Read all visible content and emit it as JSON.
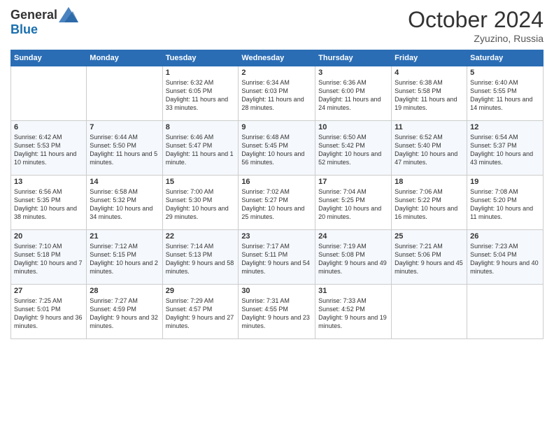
{
  "header": {
    "logo_general": "General",
    "logo_blue": "Blue",
    "month": "October 2024",
    "location": "Zyuzino, Russia"
  },
  "days_of_week": [
    "Sunday",
    "Monday",
    "Tuesday",
    "Wednesday",
    "Thursday",
    "Friday",
    "Saturday"
  ],
  "weeks": [
    [
      {
        "day": "",
        "sunrise": "",
        "sunset": "",
        "daylight": ""
      },
      {
        "day": "",
        "sunrise": "",
        "sunset": "",
        "daylight": ""
      },
      {
        "day": "1",
        "sunrise": "Sunrise: 6:32 AM",
        "sunset": "Sunset: 6:05 PM",
        "daylight": "Daylight: 11 hours and 33 minutes."
      },
      {
        "day": "2",
        "sunrise": "Sunrise: 6:34 AM",
        "sunset": "Sunset: 6:03 PM",
        "daylight": "Daylight: 11 hours and 28 minutes."
      },
      {
        "day": "3",
        "sunrise": "Sunrise: 6:36 AM",
        "sunset": "Sunset: 6:00 PM",
        "daylight": "Daylight: 11 hours and 24 minutes."
      },
      {
        "day": "4",
        "sunrise": "Sunrise: 6:38 AM",
        "sunset": "Sunset: 5:58 PM",
        "daylight": "Daylight: 11 hours and 19 minutes."
      },
      {
        "day": "5",
        "sunrise": "Sunrise: 6:40 AM",
        "sunset": "Sunset: 5:55 PM",
        "daylight": "Daylight: 11 hours and 14 minutes."
      }
    ],
    [
      {
        "day": "6",
        "sunrise": "Sunrise: 6:42 AM",
        "sunset": "Sunset: 5:53 PM",
        "daylight": "Daylight: 11 hours and 10 minutes."
      },
      {
        "day": "7",
        "sunrise": "Sunrise: 6:44 AM",
        "sunset": "Sunset: 5:50 PM",
        "daylight": "Daylight: 11 hours and 5 minutes."
      },
      {
        "day": "8",
        "sunrise": "Sunrise: 6:46 AM",
        "sunset": "Sunset: 5:47 PM",
        "daylight": "Daylight: 11 hours and 1 minute."
      },
      {
        "day": "9",
        "sunrise": "Sunrise: 6:48 AM",
        "sunset": "Sunset: 5:45 PM",
        "daylight": "Daylight: 10 hours and 56 minutes."
      },
      {
        "day": "10",
        "sunrise": "Sunrise: 6:50 AM",
        "sunset": "Sunset: 5:42 PM",
        "daylight": "Daylight: 10 hours and 52 minutes."
      },
      {
        "day": "11",
        "sunrise": "Sunrise: 6:52 AM",
        "sunset": "Sunset: 5:40 PM",
        "daylight": "Daylight: 10 hours and 47 minutes."
      },
      {
        "day": "12",
        "sunrise": "Sunrise: 6:54 AM",
        "sunset": "Sunset: 5:37 PM",
        "daylight": "Daylight: 10 hours and 43 minutes."
      }
    ],
    [
      {
        "day": "13",
        "sunrise": "Sunrise: 6:56 AM",
        "sunset": "Sunset: 5:35 PM",
        "daylight": "Daylight: 10 hours and 38 minutes."
      },
      {
        "day": "14",
        "sunrise": "Sunrise: 6:58 AM",
        "sunset": "Sunset: 5:32 PM",
        "daylight": "Daylight: 10 hours and 34 minutes."
      },
      {
        "day": "15",
        "sunrise": "Sunrise: 7:00 AM",
        "sunset": "Sunset: 5:30 PM",
        "daylight": "Daylight: 10 hours and 29 minutes."
      },
      {
        "day": "16",
        "sunrise": "Sunrise: 7:02 AM",
        "sunset": "Sunset: 5:27 PM",
        "daylight": "Daylight: 10 hours and 25 minutes."
      },
      {
        "day": "17",
        "sunrise": "Sunrise: 7:04 AM",
        "sunset": "Sunset: 5:25 PM",
        "daylight": "Daylight: 10 hours and 20 minutes."
      },
      {
        "day": "18",
        "sunrise": "Sunrise: 7:06 AM",
        "sunset": "Sunset: 5:22 PM",
        "daylight": "Daylight: 10 hours and 16 minutes."
      },
      {
        "day": "19",
        "sunrise": "Sunrise: 7:08 AM",
        "sunset": "Sunset: 5:20 PM",
        "daylight": "Daylight: 10 hours and 11 minutes."
      }
    ],
    [
      {
        "day": "20",
        "sunrise": "Sunrise: 7:10 AM",
        "sunset": "Sunset: 5:18 PM",
        "daylight": "Daylight: 10 hours and 7 minutes."
      },
      {
        "day": "21",
        "sunrise": "Sunrise: 7:12 AM",
        "sunset": "Sunset: 5:15 PM",
        "daylight": "Daylight: 10 hours and 2 minutes."
      },
      {
        "day": "22",
        "sunrise": "Sunrise: 7:14 AM",
        "sunset": "Sunset: 5:13 PM",
        "daylight": "Daylight: 9 hours and 58 minutes."
      },
      {
        "day": "23",
        "sunrise": "Sunrise: 7:17 AM",
        "sunset": "Sunset: 5:11 PM",
        "daylight": "Daylight: 9 hours and 54 minutes."
      },
      {
        "day": "24",
        "sunrise": "Sunrise: 7:19 AM",
        "sunset": "Sunset: 5:08 PM",
        "daylight": "Daylight: 9 hours and 49 minutes."
      },
      {
        "day": "25",
        "sunrise": "Sunrise: 7:21 AM",
        "sunset": "Sunset: 5:06 PM",
        "daylight": "Daylight: 9 hours and 45 minutes."
      },
      {
        "day": "26",
        "sunrise": "Sunrise: 7:23 AM",
        "sunset": "Sunset: 5:04 PM",
        "daylight": "Daylight: 9 hours and 40 minutes."
      }
    ],
    [
      {
        "day": "27",
        "sunrise": "Sunrise: 7:25 AM",
        "sunset": "Sunset: 5:01 PM",
        "daylight": "Daylight: 9 hours and 36 minutes."
      },
      {
        "day": "28",
        "sunrise": "Sunrise: 7:27 AM",
        "sunset": "Sunset: 4:59 PM",
        "daylight": "Daylight: 9 hours and 32 minutes."
      },
      {
        "day": "29",
        "sunrise": "Sunrise: 7:29 AM",
        "sunset": "Sunset: 4:57 PM",
        "daylight": "Daylight: 9 hours and 27 minutes."
      },
      {
        "day": "30",
        "sunrise": "Sunrise: 7:31 AM",
        "sunset": "Sunset: 4:55 PM",
        "daylight": "Daylight: 9 hours and 23 minutes."
      },
      {
        "day": "31",
        "sunrise": "Sunrise: 7:33 AM",
        "sunset": "Sunset: 4:52 PM",
        "daylight": "Daylight: 9 hours and 19 minutes."
      },
      {
        "day": "",
        "sunrise": "",
        "sunset": "",
        "daylight": ""
      },
      {
        "day": "",
        "sunrise": "",
        "sunset": "",
        "daylight": ""
      }
    ]
  ]
}
